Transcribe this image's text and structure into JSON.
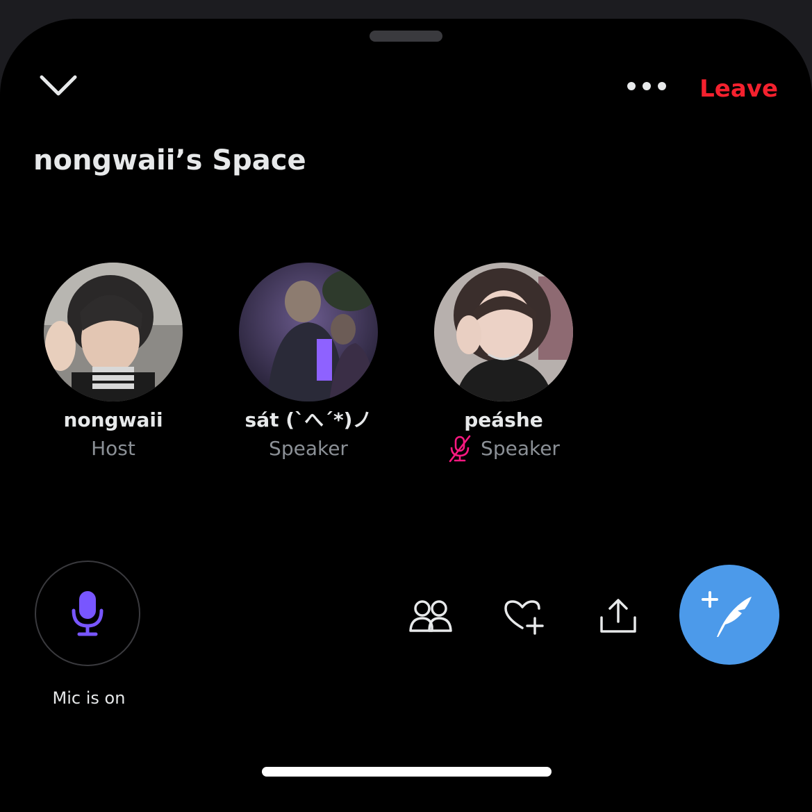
{
  "space": {
    "title": "nongwaii’s Space",
    "leave_label": "Leave"
  },
  "participants": [
    {
      "name": "nongwaii",
      "role": "Host",
      "muted": false
    },
    {
      "name": "sát (`へ´*)ノ",
      "role": "Speaker",
      "muted": false
    },
    {
      "name": "peáshe",
      "role": "Speaker",
      "muted": true
    }
  ],
  "mic": {
    "label": "Mic is on",
    "color": "#7856ff"
  },
  "actions": [
    "people-icon",
    "heart-plus-icon",
    "share-icon",
    "compose-tweet-icon"
  ],
  "colors": {
    "accent": "#4c9aea",
    "leave": "#f4212e",
    "muted": "#f91880"
  }
}
